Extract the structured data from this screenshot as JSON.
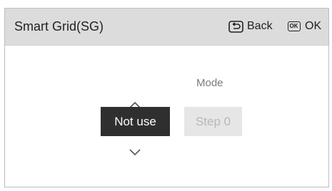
{
  "header": {
    "title": "Smart Grid(SG)",
    "back_label": "Back",
    "ok_icon_text": "OK",
    "ok_label": "OK"
  },
  "icons": {
    "back": "back-return-icon",
    "ok": "ok-key-icon",
    "up": "chevron-up-icon",
    "down": "chevron-down-icon"
  },
  "main": {
    "mode_label": "Mode",
    "selected_value": "Not use",
    "step_value": "Step 0"
  },
  "colors": {
    "header_bg": "#dcdcdc",
    "selected_bg": "#2f2f2f",
    "selected_text": "#ffffff",
    "step_bg": "#e6e6e6",
    "step_text": "#b8b8b8"
  }
}
